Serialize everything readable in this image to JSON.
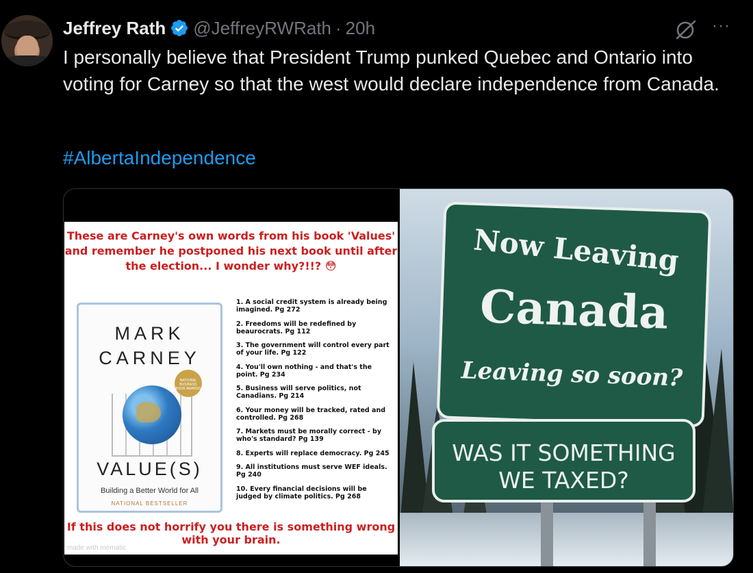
{
  "tweet": {
    "author_name": "Jeffrey Rath",
    "handle": "@JeffreyRWRath",
    "separator": "·",
    "time": "20h",
    "more_label": "···",
    "text": "I personally believe that President Trump punked Quebec and Ontario into voting for Carney so that the west would declare independence from Canada.",
    "hashtag": "#AlbertaIndependence",
    "colors": {
      "background": "#000000",
      "link": "#1d9bf0",
      "muted": "#71767b",
      "verified": "#1d9bf0"
    }
  },
  "media": {
    "left": {
      "heading": "These are Carney's own words from his book 'Values' and remember he postponed his next book until after the election... I wonder why?!!? 😳",
      "book": {
        "author": "MARK CARNEY",
        "title": "VALUE(S)",
        "subtitle": "Building a Better World for All",
        "badge": "NATIONAL BESTSELLER",
        "award": "NATIONAL BUSINESS BOOK AWARDS"
      },
      "list": [
        "1. A social credit system is already being imagined. Pg 272",
        "2. Freedoms will be redefined by beaurocrats. Pg 112",
        "3. The government will control every part of your life. Pg 122",
        "4. You'll own nothing - and that's the point. Pg 234",
        "5. Business will serve politics, not Canadians. Pg 214",
        "6. Your money will be tracked, rated and controlled. Pg 268",
        "7. Markets must be morally correct - by who's standard? Pg 139",
        "8. Experts will replace democracy. Pg 245",
        "9. All institutions must serve WEF ideals. Pg 240",
        "10. Every financial decisions will be judged by climate politics. Pg 268"
      ],
      "footer": "If this does not horrify you there is something wrong with your brain.",
      "watermark": "made with mematic"
    },
    "right": {
      "sign_line1": "Now Leaving",
      "sign_line2": "Canada",
      "sign_line3": "Leaving so soon?",
      "sign2_line1": "WAS IT SOMETHING",
      "sign2_line2": "WE TAXED?"
    }
  }
}
